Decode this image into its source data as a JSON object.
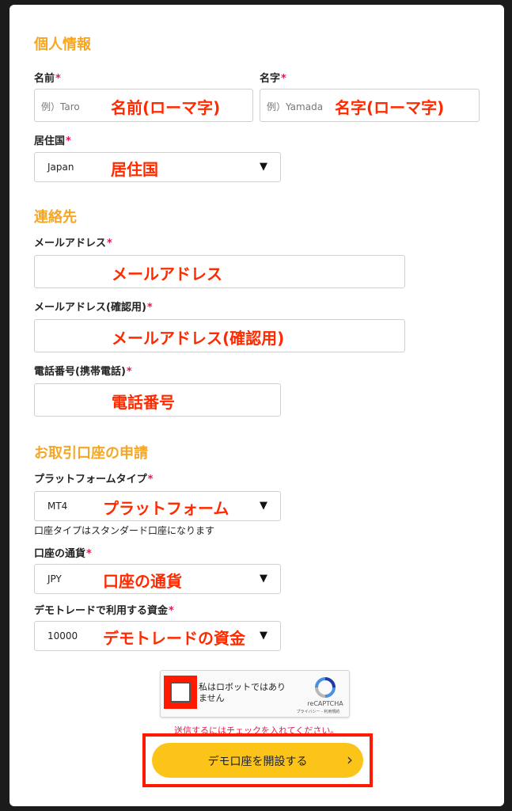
{
  "personal": {
    "title": "個人情報",
    "first_name": {
      "label": "名前",
      "placeholder": "例）Taro",
      "annotation": "名前(ローマ字)"
    },
    "last_name": {
      "label": "名字",
      "placeholder": "例）Yamada",
      "annotation": "名字(ローマ字)"
    },
    "country": {
      "label": "居住国",
      "value": "Japan",
      "annotation": "居住国"
    }
  },
  "contact": {
    "title": "連絡先",
    "email": {
      "label": "メールアドレス",
      "annotation": "メールアドレス"
    },
    "email_confirm": {
      "label": "メールアドレス(確認用)",
      "annotation": "メールアドレス(確認用)"
    },
    "phone": {
      "label": "電話番号(携帯電話)",
      "annotation": "電話番号"
    }
  },
  "account": {
    "title": "お取引口座の申請",
    "platform": {
      "label": "プラットフォームタイプ",
      "value": "MT4",
      "annotation": "プラットフォーム",
      "note": "口座タイプはスタンダード口座になります"
    },
    "currency": {
      "label": "口座の通貨",
      "value": "JPY",
      "annotation": "口座の通貨"
    },
    "funds": {
      "label": "デモトレードで利用する資金",
      "value": "10000",
      "annotation": "デモトレードの資金"
    }
  },
  "required_mark": "*",
  "caret": "▼",
  "recaptcha": {
    "label": "私はロボットではありません",
    "brand": "reCAPTCHA",
    "links": "プライバシー - 利用規約",
    "warning": "送信するにはチェックを入れてください。"
  },
  "submit": {
    "label": "デモ口座を開設する",
    "arrow": "›"
  },
  "colors": {
    "accent": "#f5a623",
    "annotation": "#ff2a00",
    "required": "#e8174b",
    "button": "#fcc419"
  }
}
